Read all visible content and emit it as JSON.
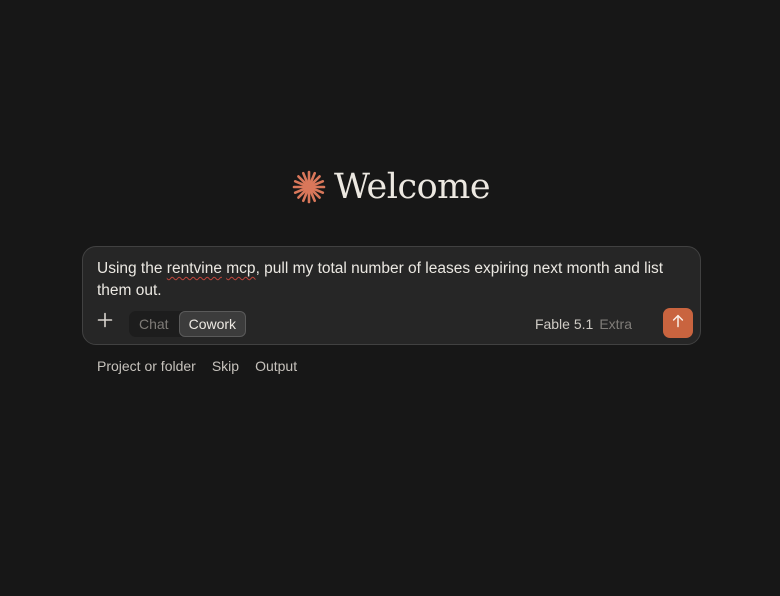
{
  "header": {
    "title": "Welcome",
    "logo_icon": "sparkle-icon",
    "accent_color": "#d9775a"
  },
  "composer": {
    "prompt_prefix": "Using the ",
    "prompt_misspelled_1": "rentvine",
    "prompt_space": " ",
    "prompt_misspelled_2": "mcp",
    "prompt_suffix": ", pull my total number of leases expiring next month and list them out.",
    "add_icon": "plus-icon",
    "modes": [
      "Chat",
      "Cowork"
    ],
    "active_mode": "Cowork",
    "model_name": "Fable 5.1",
    "model_tier": "Extra",
    "send_icon": "arrow-up-icon",
    "send_color": "#c9643f"
  },
  "footer_links": [
    "Project or folder",
    "Skip",
    "Output"
  ]
}
